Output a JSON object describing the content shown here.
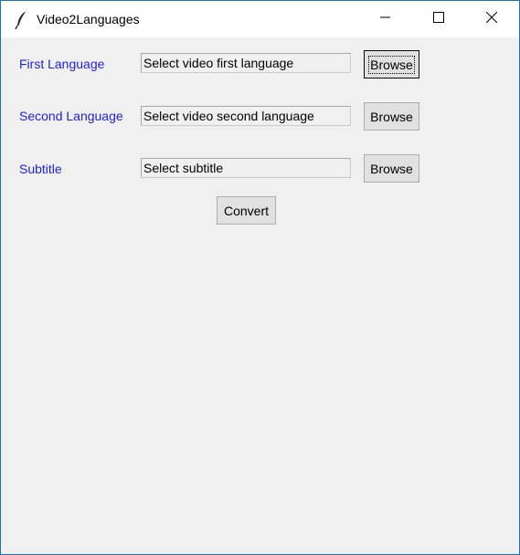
{
  "window": {
    "title": "Video2Languages",
    "icon": "feather-icon",
    "controls": [
      "minimize-icon",
      "maximize-icon",
      "close-icon"
    ]
  },
  "form": {
    "rows": [
      {
        "label": "First Language",
        "entry_value": "Select video first language",
        "button_label": "Browse"
      },
      {
        "label": "Second Language",
        "entry_value": "Select video second language",
        "button_label": "Browse"
      },
      {
        "label": "Subtitle",
        "entry_value": "Select subtitle",
        "button_label": "Browse"
      }
    ],
    "convert_label": "Convert"
  },
  "colors": {
    "label_text": "#2323d6",
    "window_border": "#1e6fb8",
    "background": "#f0f0f0",
    "button_face": "#e1e1e1"
  }
}
